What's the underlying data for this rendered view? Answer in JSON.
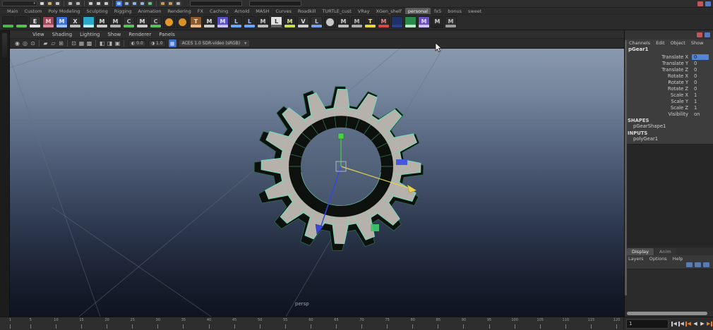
{
  "status_line": {
    "menu_set_dropdown": {
      "caret": "▾"
    },
    "icons": [
      {
        "name": "new-scene-icon",
        "color": "#d8d8d8"
      },
      {
        "name": "open-scene-icon",
        "color": "#c8b070"
      },
      {
        "name": "save-scene-icon",
        "color": "#c4c4c4"
      },
      {
        "sep": true
      },
      {
        "name": "undo-icon",
        "color": "#b8b8b8"
      },
      {
        "name": "redo-icon",
        "color": "#b8b8b8"
      },
      {
        "sep": true
      },
      {
        "name": "select-tool-icon",
        "color": "#cccccc"
      },
      {
        "name": "lasso-tool-icon",
        "color": "#cccccc"
      },
      {
        "name": "paint-select-icon",
        "color": "#cccccc"
      },
      {
        "sep": true
      },
      {
        "name": "snap-grid-icon",
        "color": "#9cc2ee",
        "active": true
      },
      {
        "name": "snap-curve-icon",
        "color": "#8ab4e8"
      },
      {
        "name": "snap-point-icon",
        "color": "#8ab4e8"
      },
      {
        "name": "snap-plane-icon",
        "color": "#8ab4e8"
      },
      {
        "name": "make-live-icon",
        "color": "#6ac08a"
      },
      {
        "sep": true
      },
      {
        "name": "render-icon",
        "color": "#c89858"
      },
      {
        "name": "ipr-render-icon",
        "color": "#c89858"
      },
      {
        "name": "render-settings-icon",
        "color": "#b0b0b0"
      }
    ],
    "fields": [
      {
        "name": "status-input-field-1"
      },
      {
        "name": "status-input-field-2"
      }
    ],
    "right_icons": [
      {
        "name": "modeling-toolkit-toggle-icon",
        "color": "#c05858"
      },
      {
        "name": "channel-box-toggle-icon",
        "color": "#5878c0"
      }
    ]
  },
  "shelf": {
    "tabs": [
      {
        "label": "Main"
      },
      {
        "label": "Custom"
      },
      {
        "label": "Poly Modeling"
      },
      {
        "label": "Sculpting"
      },
      {
        "label": "Rigging"
      },
      {
        "label": "Animation"
      },
      {
        "label": "Rendering"
      },
      {
        "label": "FX"
      },
      {
        "label": "Caching"
      },
      {
        "label": "Arnold"
      },
      {
        "label": "MASH"
      },
      {
        "label": "Curves"
      },
      {
        "label": "Roadkill"
      },
      {
        "label": "TURTLE_cust"
      },
      {
        "label": "VRay"
      },
      {
        "label": "XGen_shelf"
      },
      {
        "label": "personal",
        "active": true
      },
      {
        "label": "fx5"
      },
      {
        "label": "bonus"
      },
      {
        "label": "sweet"
      }
    ],
    "icons": [
      {
        "bg": "#242424",
        "badge": "#4db84d"
      },
      {
        "bg": "#242424",
        "badge": "#58c24a"
      },
      {
        "bg": "#343434",
        "badge": "#e0e0e0",
        "letter": "E",
        "acc": "#eeeeee"
      },
      {
        "bg": "#a04458",
        "badge": "#d88a9a",
        "letter": "M",
        "acc": "#f0d0d8"
      },
      {
        "bg": "#3a6fd8",
        "badge": "#9ec0f8",
        "letter": "M",
        "acc": "#e8f0ff"
      },
      {
        "bg": "#2e2e2e",
        "badge": "#bababa",
        "letter": "X",
        "acc": "#dddddd"
      },
      {
        "bg": "#2ba8c8",
        "badge": "#bfeaf8"
      },
      {
        "bg": "#282828",
        "badge": "#c8c8c8",
        "letter": "M",
        "acc": "#dddddd"
      },
      {
        "bg": "#282828",
        "badge": "#b0b0b0",
        "letter": "M",
        "acc": "#cccccc"
      },
      {
        "bg": "#2e2e2e",
        "badge": "#57c257",
        "letter": "C",
        "acc": "#bbbbbb"
      },
      {
        "bg": "#2e2e2e",
        "badge": "#c8c8c8",
        "letter": "M",
        "acc": "#dddddd"
      },
      {
        "bg": "#2e2e2e",
        "badge": "#57c257",
        "letter": "C",
        "acc": "#bbbbbb"
      },
      {
        "bg": "#282828",
        "badge": "#e09a28",
        "circle": true
      },
      {
        "bg": "#282828",
        "badge": "#d89028",
        "circle": true
      },
      {
        "bg": "#8a5a2e",
        "badge": "#e8b880",
        "letter": "T",
        "acc": "#f8e0c0"
      },
      {
        "bg": "#282828",
        "badge": "#cccccc",
        "letter": "M",
        "acc": "#dddddd"
      },
      {
        "bg": "#5a50c8",
        "badge": "#c8c0f8",
        "letter": "M",
        "acc": "#e8e4ff"
      },
      {
        "bg": "#282828",
        "badge": "#6aa8ff",
        "letter": "L",
        "acc": "#9ec4ff"
      },
      {
        "bg": "#282828",
        "badge": "#6aa8ff",
        "letter": "L",
        "acc": "#9ec4ff"
      },
      {
        "bg": "#282828",
        "badge": "#bbbbbb",
        "letter": "M",
        "acc": "#cccccc"
      },
      {
        "bg": "#e0e0e0",
        "badge": "#606060",
        "letter": "L",
        "acc": "#303030"
      },
      {
        "bg": "#282828",
        "badge": "#c8e048",
        "letter": "M",
        "acc": "#d8e880"
      },
      {
        "bg": "#303030",
        "badge": "#cccccc",
        "letter": "V",
        "acc": "#dddddd"
      },
      {
        "bg": "#303030",
        "badge": "#7a9fe8",
        "letter": "L",
        "acc": "#aac4f4"
      },
      {
        "bg": "#282828",
        "badge": "#c8c8c8",
        "circle": true
      },
      {
        "bg": "#282828",
        "badge": "#bbbbbb",
        "letter": "M",
        "acc": "#cccccc"
      },
      {
        "bg": "#282828",
        "badge": "#aaaaaa",
        "letter": "M",
        "acc": "#bbbbbb"
      },
      {
        "bg": "#282828",
        "badge": "#e8d838",
        "letter": "T",
        "acc": "#f0e070"
      },
      {
        "bg": "#282828",
        "badge": "#d84848",
        "letter": "M",
        "acc": "#e88888"
      },
      {
        "bg": "#20306a",
        "badge": "#2a3f88"
      },
      {
        "bg": "#2a8a4a",
        "badge": "#bfe8c8"
      },
      {
        "bg": "#6a50c0",
        "badge": "#d0c0ff",
        "letter": "M",
        "acc": "#e4d8ff"
      },
      {
        "bg": "#282828",
        "badge": "#222222",
        "letter": "M",
        "acc": "#cccccc"
      },
      {
        "bg": "#2e2e2e",
        "badge": "#9a9a9a",
        "letter": "M",
        "acc": "#bbbbbb"
      }
    ]
  },
  "viewport_panel": {
    "menus": [
      "View",
      "Shading",
      "Lighting",
      "Show",
      "Renderer",
      "Panels"
    ],
    "toolbar": {
      "icons": [
        "◉",
        "◎",
        "⊙",
        "|",
        "▰",
        "▱",
        "⊞",
        "|",
        "⊡",
        "▦",
        "▩",
        "|",
        "◧",
        "◨",
        "▣",
        "|"
      ],
      "exposure_icon": "◐",
      "exposure": "0.0",
      "gamma_icon": "◑",
      "gamma": "1.0",
      "color_mgmt_icon": "▦",
      "view_transform": "ACES 1.0 SDR-video (sRGB)",
      "dropdown_caret": "▾"
    },
    "camera_label": "persp",
    "colors": {
      "sky_top": "#8a99ad",
      "ground_bottom": "#10141d",
      "grid_line": "#66707f",
      "wire": "#70ddbb",
      "face": "#b6b2ab",
      "side": "#0c110d",
      "axis_x": "#e8d44f",
      "axis_y": "#4ad04a",
      "axis_z": "#3946d8",
      "plane_handle_blue": "#4053e0",
      "plane_handle_green": "#3fc46a"
    },
    "gear": {
      "teeth": 16,
      "outer_radius": 113,
      "valley_radius": 86,
      "ring_radius": 74,
      "hole_radius": 57
    }
  },
  "channel_box": {
    "menus": [
      "Channels",
      "Edit",
      "Object",
      "Show"
    ],
    "object_name": "pGear1",
    "attributes": [
      {
        "name": "Translate X",
        "value": "0",
        "selected": true
      },
      {
        "name": "Translate Y",
        "value": "0"
      },
      {
        "name": "Translate Z",
        "value": "0"
      },
      {
        "name": "Rotate X",
        "value": "0"
      },
      {
        "name": "Rotate Y",
        "value": "0"
      },
      {
        "name": "Rotate Z",
        "value": "0"
      },
      {
        "name": "Scale X",
        "value": "1"
      },
      {
        "name": "Scale Y",
        "value": "1"
      },
      {
        "name": "Scale Z",
        "value": "1"
      },
      {
        "name": "Visibility",
        "value": "on"
      }
    ],
    "sections": [
      {
        "title": "SHAPES",
        "items": [
          "pGearShape1"
        ]
      },
      {
        "title": "INPUTS",
        "items": [
          "polyGear1"
        ]
      }
    ]
  },
  "layer_editor": {
    "tabs": [
      {
        "label": "Display",
        "active": true
      },
      {
        "label": "Anim"
      }
    ],
    "menus": [
      "Layers",
      "Options",
      "Help"
    ],
    "icons": [
      {
        "name": "move-selected-to-layer-icon"
      },
      {
        "name": "create-empty-layer-icon"
      },
      {
        "name": "create-layer-from-selected-icon"
      }
    ]
  },
  "timeline": {
    "start": 1,
    "end": 120,
    "label_step": 5
  },
  "playback": {
    "current_frame": "1",
    "buttons": [
      {
        "name": "go-to-start-button",
        "glyph": "◀",
        "bar": "left",
        "color": "#c8c8c8"
      },
      {
        "name": "step-back-frame-button",
        "glyph": "◀",
        "bar": "left",
        "color": "#c8c8c8"
      },
      {
        "name": "step-back-key-button",
        "glyph": "◀",
        "bar": "left",
        "color": "#e0822a"
      },
      {
        "name": "play-backwards-button",
        "glyph": "◀",
        "color": "#d8d8d8"
      },
      {
        "name": "play-forwards-button",
        "glyph": "▶",
        "color": "#d8d8d8"
      },
      {
        "name": "step-forward-key-button",
        "glyph": "▶",
        "bar": "right",
        "color": "#e0822a"
      }
    ]
  }
}
